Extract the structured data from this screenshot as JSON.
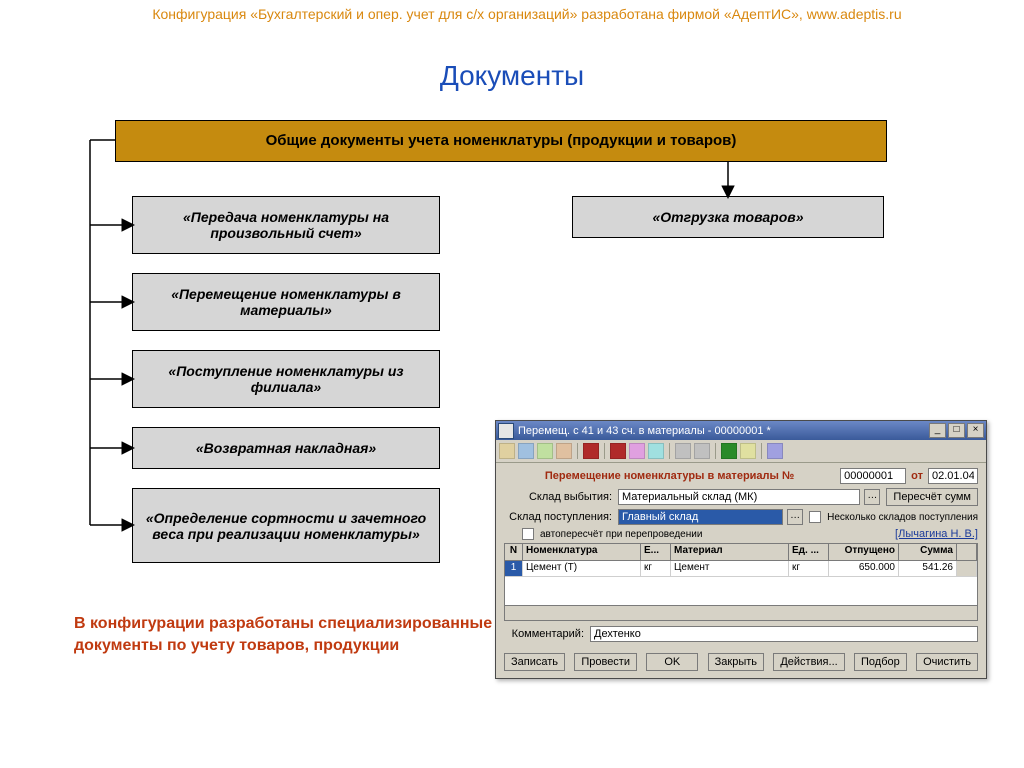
{
  "header_text": "Конфигурация «Бухгалтерский и опер. учет для с/х организаций» разработана фирмой «АдептИС», www.adeptis.ru",
  "title": "Документы",
  "main_box": "Общие документы учета номенклатуры (продукции и товаров)",
  "boxes": {
    "b1": "«Передача номенклатуры на произвольный счет»",
    "b2": "«Перемещение номенклатуры в материалы»",
    "b3": "«Поступление номенклатуры из филиала»",
    "b4": "«Возвратная накладная»",
    "b5": "«Определение сортности и зачетного веса при реализации номенклатуры»",
    "b6": "«Отгрузка товаров»"
  },
  "bottom_note": "В конфигурации разработаны специализированные документы по учету товаров, продукции",
  "app": {
    "title": "Перемещ. с 41 и 43 сч. в материалы - 00000001 *",
    "form_title": "Перемещение номенклатуры в материалы №",
    "doc_no": "00000001",
    "date_label": "от",
    "date": "02.01.04",
    "row1_label": "Склад выбытия:",
    "row1_value": "Материальный склад (МК)",
    "row1_btn": "Пересчёт сумм",
    "row2_label": "Склад поступления:",
    "row2_value": "Главный склад",
    "row2_chk": "Несколько складов поступления",
    "row3_chk": "автопересчёт при перепроведении",
    "user": "[Лычагина Н. В.]",
    "columns": {
      "n": "N",
      "nmk": "Номенклатура",
      "e": "Е...",
      "mat": "Материал",
      "ed": "Ед. ...",
      "otp": "Отпущено",
      "sum": "Сумма"
    },
    "row": {
      "n": "1",
      "nmk": "Цемент (Т)",
      "e": "кг",
      "mat": "Цемент",
      "ed": "кг",
      "otp": "650.000",
      "sum": "541.26"
    },
    "comment_label": "Комментарий:",
    "comment_value": "Дехтенко",
    "buttons": {
      "zap": "Записать",
      "prov": "Провести",
      "ok": "OK",
      "zak": "Закрыть",
      "dei": "Действия...",
      "podb": "Подбор",
      "och": "Очистить"
    }
  }
}
